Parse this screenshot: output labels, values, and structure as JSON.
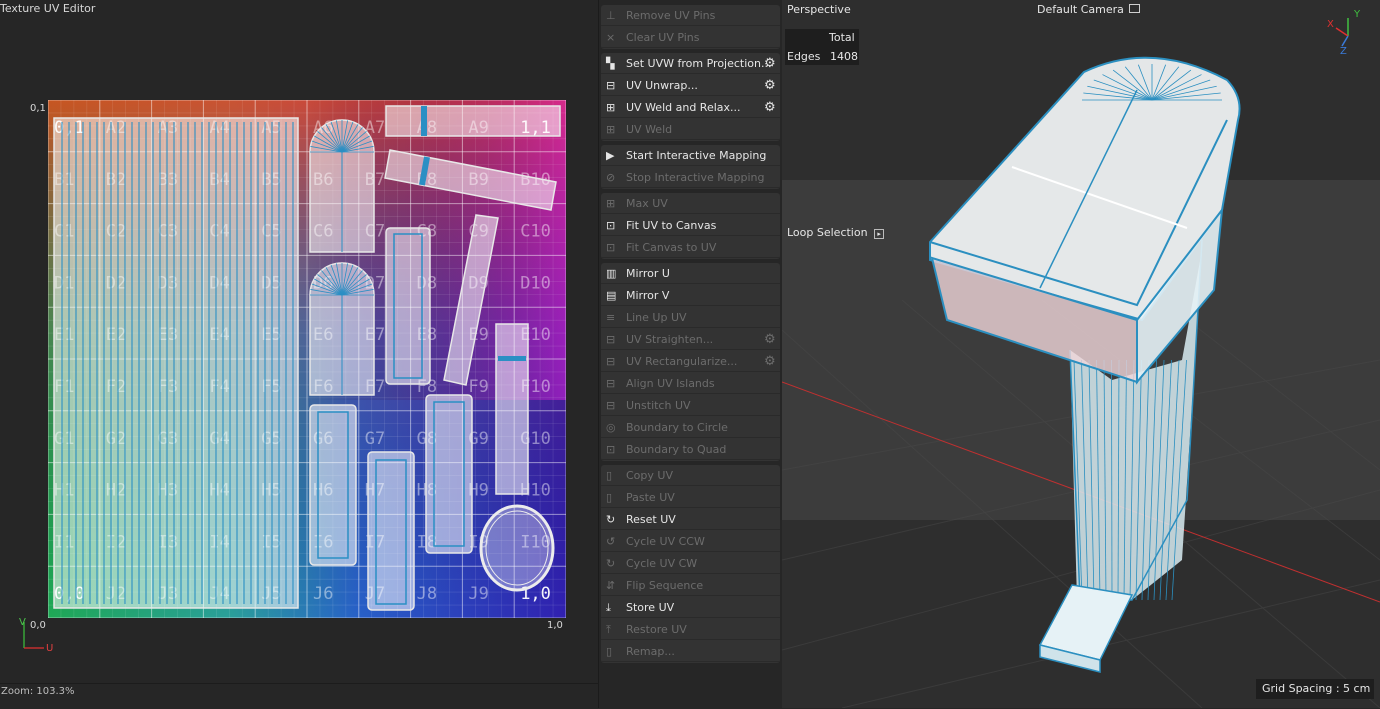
{
  "uv_editor": {
    "title": "Texture UV Editor",
    "corners": {
      "top_left": "0,1",
      "bottom_left": "0,0",
      "bottom_right": "1,0"
    },
    "axis": {
      "v": "V",
      "u": "U"
    },
    "zoom": "Zoom: 103.3%",
    "rows": [
      "A",
      "B",
      "C",
      "D",
      "E",
      "F",
      "G",
      "H",
      "I",
      "J"
    ],
    "cols": [
      "1",
      "2",
      "3",
      "4",
      "5",
      "6",
      "7",
      "8",
      "9",
      "10"
    ],
    "cell_corner_labels": {
      "top_left": "0,1",
      "top_right": "1,1",
      "bottom_left": "0,0",
      "bottom_right": "1,0"
    }
  },
  "commands": {
    "groups": [
      {
        "items": [
          {
            "label": "Remove UV Pins",
            "enabled": false,
            "icon": "pin-icon"
          },
          {
            "label": "Clear UV Pins",
            "enabled": false,
            "icon": "clear-icon"
          }
        ]
      },
      {
        "items": [
          {
            "label": "Set UVW from Projection...",
            "enabled": true,
            "icon": "checker-icon",
            "gear": true
          },
          {
            "label": "UV Unwrap...",
            "enabled": true,
            "icon": "unwrap-icon",
            "gear": true
          },
          {
            "label": "UV Weld and Relax...",
            "enabled": true,
            "icon": "weld-relax-icon",
            "gear": true
          },
          {
            "label": "UV Weld",
            "enabled": false,
            "icon": "weld-icon"
          }
        ]
      },
      {
        "items": [
          {
            "label": "Start Interactive Mapping",
            "enabled": true,
            "icon": "play-icon"
          },
          {
            "label": "Stop Interactive Mapping",
            "enabled": false,
            "icon": "stop-icon"
          }
        ]
      },
      {
        "items": [
          {
            "label": "Max UV",
            "enabled": false,
            "icon": "max-uv-icon"
          },
          {
            "label": "Fit UV to Canvas",
            "enabled": true,
            "icon": "fit-uv-icon"
          },
          {
            "label": "Fit Canvas to UV",
            "enabled": false,
            "icon": "fit-canvas-icon"
          }
        ]
      },
      {
        "items": [
          {
            "label": "Mirror U",
            "enabled": true,
            "icon": "mirror-u-icon"
          },
          {
            "label": "Mirror V",
            "enabled": true,
            "icon": "mirror-v-icon"
          },
          {
            "label": "Line Up UV",
            "enabled": false,
            "icon": "line-up-icon"
          },
          {
            "label": "UV Straighten...",
            "enabled": false,
            "icon": "straighten-icon",
            "gear": true
          },
          {
            "label": "UV Rectangularize...",
            "enabled": false,
            "icon": "rectangularize-icon",
            "gear": true
          },
          {
            "label": "Align UV Islands",
            "enabled": false,
            "icon": "align-icon"
          },
          {
            "label": "Unstitch UV",
            "enabled": false,
            "icon": "unstitch-icon"
          },
          {
            "label": "Boundary to Circle",
            "enabled": false,
            "icon": "circle-icon"
          },
          {
            "label": "Boundary to Quad",
            "enabled": false,
            "icon": "quad-icon"
          }
        ]
      },
      {
        "items": [
          {
            "label": "Copy UV",
            "enabled": false,
            "icon": "copy-icon"
          },
          {
            "label": "Paste UV",
            "enabled": false,
            "icon": "paste-icon"
          },
          {
            "label": "Reset UV",
            "enabled": true,
            "icon": "reset-icon"
          },
          {
            "label": "Cycle UV CCW",
            "enabled": false,
            "icon": "cycle-ccw-icon"
          },
          {
            "label": "Cycle UV CW",
            "enabled": false,
            "icon": "cycle-cw-icon"
          },
          {
            "label": "Flip Sequence",
            "enabled": false,
            "icon": "flip-icon"
          },
          {
            "label": "Store UV",
            "enabled": true,
            "icon": "store-icon"
          },
          {
            "label": "Restore UV",
            "enabled": false,
            "icon": "restore-icon"
          },
          {
            "label": "Remap...",
            "enabled": false,
            "icon": "remap-icon"
          }
        ]
      }
    ]
  },
  "viewport": {
    "name": "Perspective",
    "camera": "Default Camera",
    "stats": {
      "header": "Total",
      "label": "Edges",
      "value": "1408"
    },
    "loop_selection": "Loop Selection",
    "grid_spacing": "Grid Spacing : 5 cm",
    "axes": {
      "x": "X",
      "y": "Y",
      "z": "Z"
    }
  },
  "colors": {
    "accent_mesh": "#4aa3d4",
    "bg_panel": "#262626",
    "bg_button": "#333333",
    "axis_x": "#e03030",
    "axis_y": "#40c040",
    "axis_z": "#3a7ad8"
  }
}
